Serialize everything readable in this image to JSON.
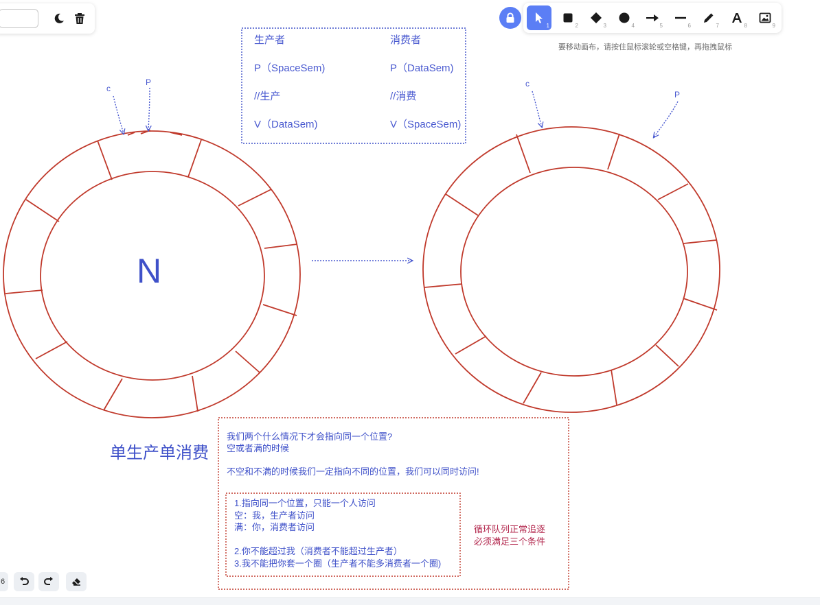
{
  "menu": {
    "input_value": "",
    "theme_icon": "moon-icon",
    "clear_icon": "trash-icon"
  },
  "toolbar": {
    "lock_icon": "lock-icon",
    "tools": [
      {
        "name": "select",
        "icon": "pointer-icon",
        "key": "1",
        "active": true
      },
      {
        "name": "rectangle",
        "icon": "square-icon",
        "key": "2"
      },
      {
        "name": "diamond",
        "icon": "diamond-icon",
        "key": "3"
      },
      {
        "name": "ellipse",
        "icon": "circle-icon",
        "key": "4"
      },
      {
        "name": "arrow",
        "icon": "arrow-icon",
        "key": "5"
      },
      {
        "name": "line",
        "icon": "line-icon",
        "key": "6"
      },
      {
        "name": "draw",
        "icon": "pencil-icon",
        "key": "7"
      },
      {
        "name": "text",
        "icon": "text-icon",
        "key": "8"
      },
      {
        "name": "image",
        "icon": "image-icon",
        "key": "9"
      }
    ],
    "hint": "要移动画布，请按住鼠标滚轮或空格键，再拖拽鼠标"
  },
  "colors": {
    "accent": "#5b7ef5",
    "ink_blue": "#3f51c9",
    "ink_red": "#c0392b",
    "ink_pink": "#b3284e"
  },
  "canvas": {
    "table": {
      "producer_header": "生产者",
      "consumer_header": "消费者",
      "producer_lines": [
        "P（SpaceSem)",
        "//生产",
        "V（DataSem)"
      ],
      "consumer_lines": [
        "P（DataSem)",
        "//消费",
        "V（SpaceSem)"
      ]
    },
    "ring_left": {
      "center_label": "N",
      "pointer_c": "c",
      "pointer_p": "P"
    },
    "ring_right": {
      "pointer_c": "c",
      "pointer_p": "P"
    },
    "title": "单生产单消费",
    "question_box": {
      "lines": [
        "我们两个什么情况下才会指向同一个位置?",
        "空或者满的时候",
        "",
        "不空和不满的时候我们一定指向不同的位置，我们可以同时访问!"
      ]
    },
    "rules_box": {
      "lines": [
        "1.指向同一个位置，只能一个人访问",
        "空：我，生产者访问",
        "满：你，消费者访问",
        "",
        "2.你不能超过我（消费者不能超过生产者）",
        "3.我不能把你套一个圈（生产者不能多消费者一个圈)"
      ]
    },
    "side_note": [
      "循环队列正常追逐",
      "必须满足三个条件"
    ]
  },
  "bottom": {
    "zoom_fragment": "6",
    "undo_icon": "undo-icon",
    "redo_icon": "redo-icon",
    "eraser_icon": "eraser-icon"
  }
}
